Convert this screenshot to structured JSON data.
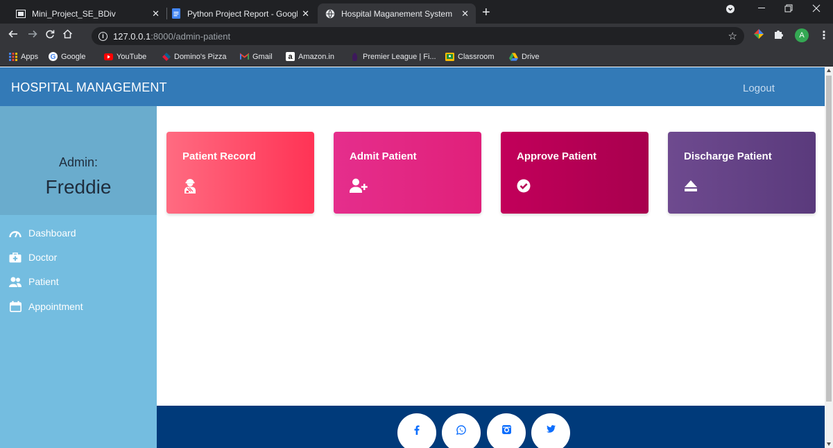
{
  "browser": {
    "tabs": [
      {
        "title": "Mini_Project_SE_BDiv",
        "close": "✕"
      },
      {
        "title": "Python Project Report - Google D",
        "close": "✕"
      },
      {
        "title": "Hospital Maganement System",
        "close": "✕"
      }
    ],
    "new_tab": "+",
    "url_host": "127.0.0.1",
    "url_rest": ":8000/admin-patient",
    "profile_initial": "A",
    "bookmarks": [
      "Apps",
      "Google",
      "YouTube",
      "Domino's Pizza",
      "Gmail",
      "Amazon.in",
      "Premier League | Fi...",
      "Classroom",
      "Drive"
    ]
  },
  "app": {
    "brand": "HOSPITAL MANAGEMENT",
    "logout": "Logout",
    "admin_label": "Admin:",
    "admin_name": "Freddie",
    "sidebar": [
      {
        "label": "Dashboard",
        "icon": "tachometer-icon"
      },
      {
        "label": "Doctor",
        "icon": "briefcase-medical-icon"
      },
      {
        "label": "Patient",
        "icon": "user-injured-icon"
      },
      {
        "label": "Appointment",
        "icon": "calendar-icon"
      }
    ],
    "cards": [
      {
        "title": "Patient Record",
        "icon": "user-injured-icon",
        "color_from": "#ff6b81",
        "color_to": "#ff3355"
      },
      {
        "title": "Admit Patient",
        "icon": "user-plus-icon",
        "color_from": "#e52e8c",
        "color_to": "#e0207a"
      },
      {
        "title": "Approve Patient",
        "icon": "check-circle-icon",
        "color_from": "#c2005a",
        "color_to": "#a8004e"
      },
      {
        "title": "Discharge Patient",
        "icon": "eject-icon",
        "color_from": "#6e4a8f",
        "color_to": "#5a3a7c"
      }
    ],
    "social": [
      "facebook-icon",
      "whatsapp-icon",
      "instagram-icon",
      "twitter-icon"
    ]
  }
}
